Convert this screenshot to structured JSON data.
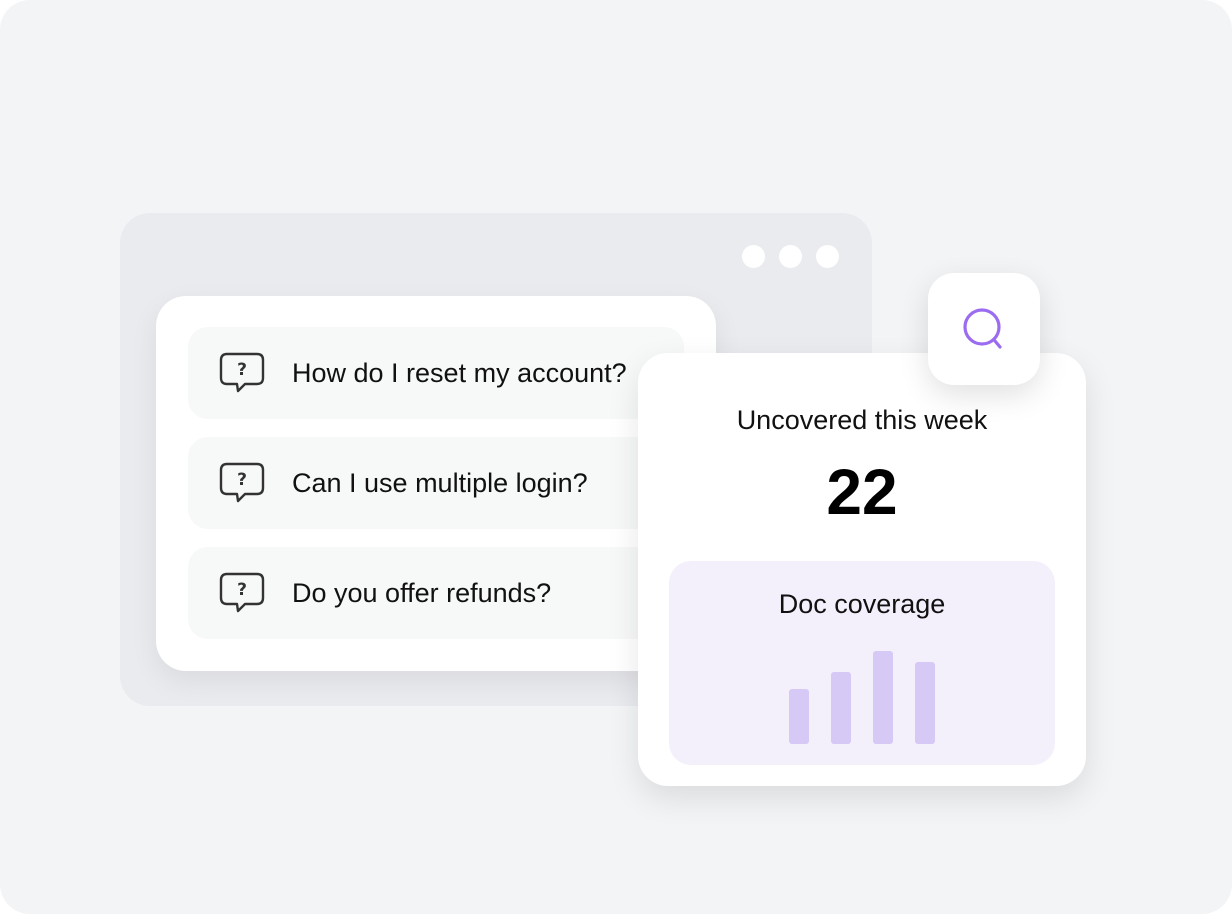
{
  "questions": [
    {
      "text": "How do I reset my account?",
      "icon": "question-bubble-icon"
    },
    {
      "text": "Can I use multiple login?",
      "icon": "question-bubble-icon"
    },
    {
      "text": "Do you offer refunds?",
      "icon": "question-bubble-icon"
    }
  ],
  "stats": {
    "label": "Uncovered this week",
    "value": "22"
  },
  "coverage": {
    "title": "Doc coverage",
    "bar_values": [
      55,
      72,
      93,
      82
    ]
  },
  "search": {
    "icon": "search-icon"
  },
  "colors": {
    "accent": "#9b6cf0",
    "bar": "#d6c9f6",
    "coverage_bg": "#f3f0fc"
  }
}
